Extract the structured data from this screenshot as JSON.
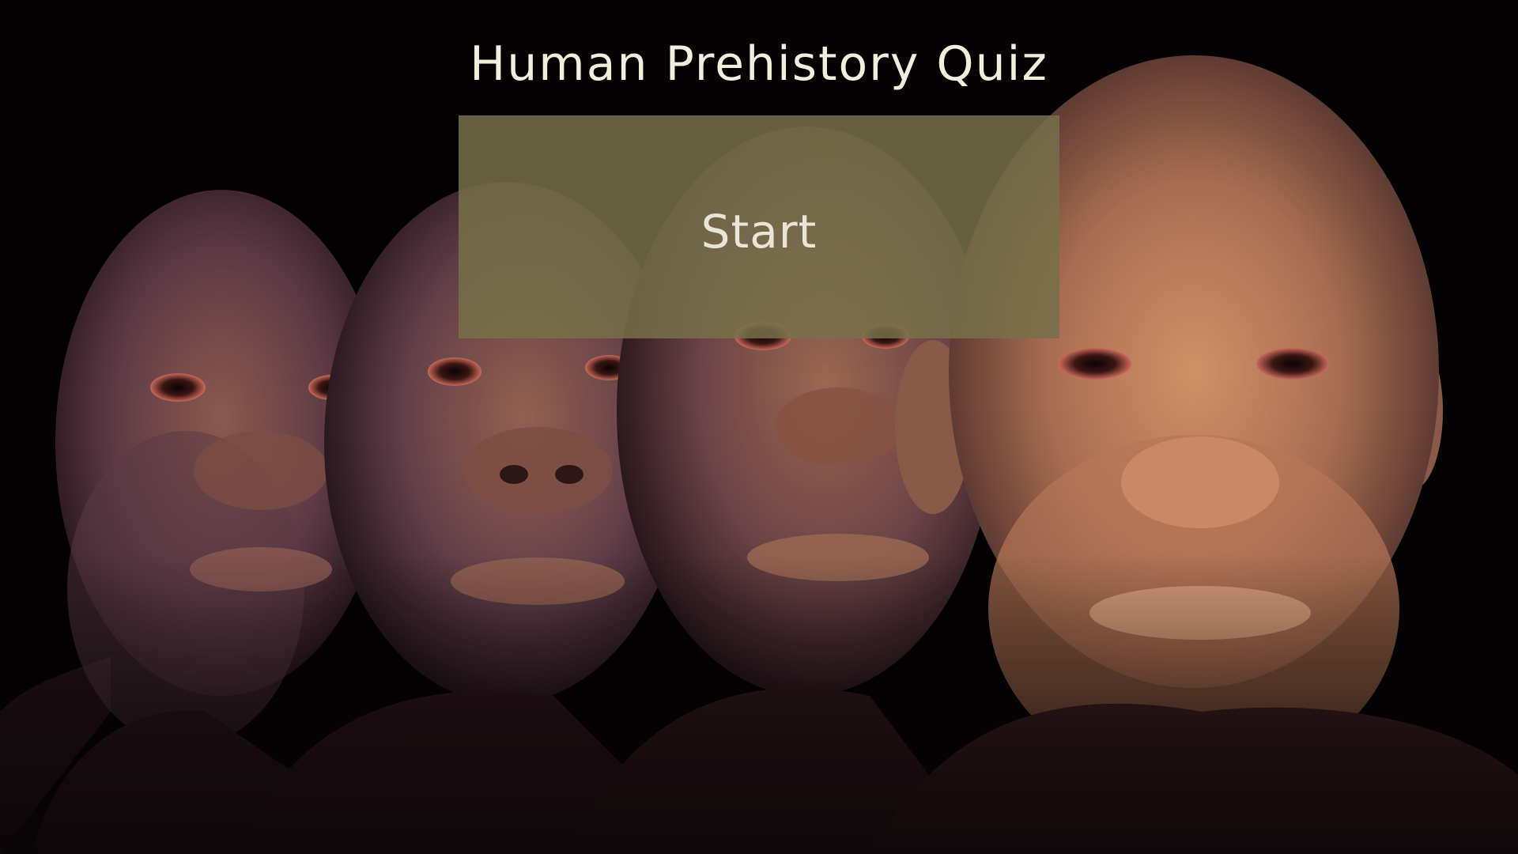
{
  "page": {
    "title": "Human Prehistory Quiz"
  },
  "start_button": {
    "label": "Start"
  },
  "background": {
    "image": "hominin-faces-evolution",
    "colors": {
      "backdrop": "#030101",
      "skin_dark": "#5a3a48",
      "skin_light": "#c98a5f",
      "button_fill": "#76704b",
      "title_text": "#f1eede",
      "button_text": "#e9e5d8"
    }
  }
}
